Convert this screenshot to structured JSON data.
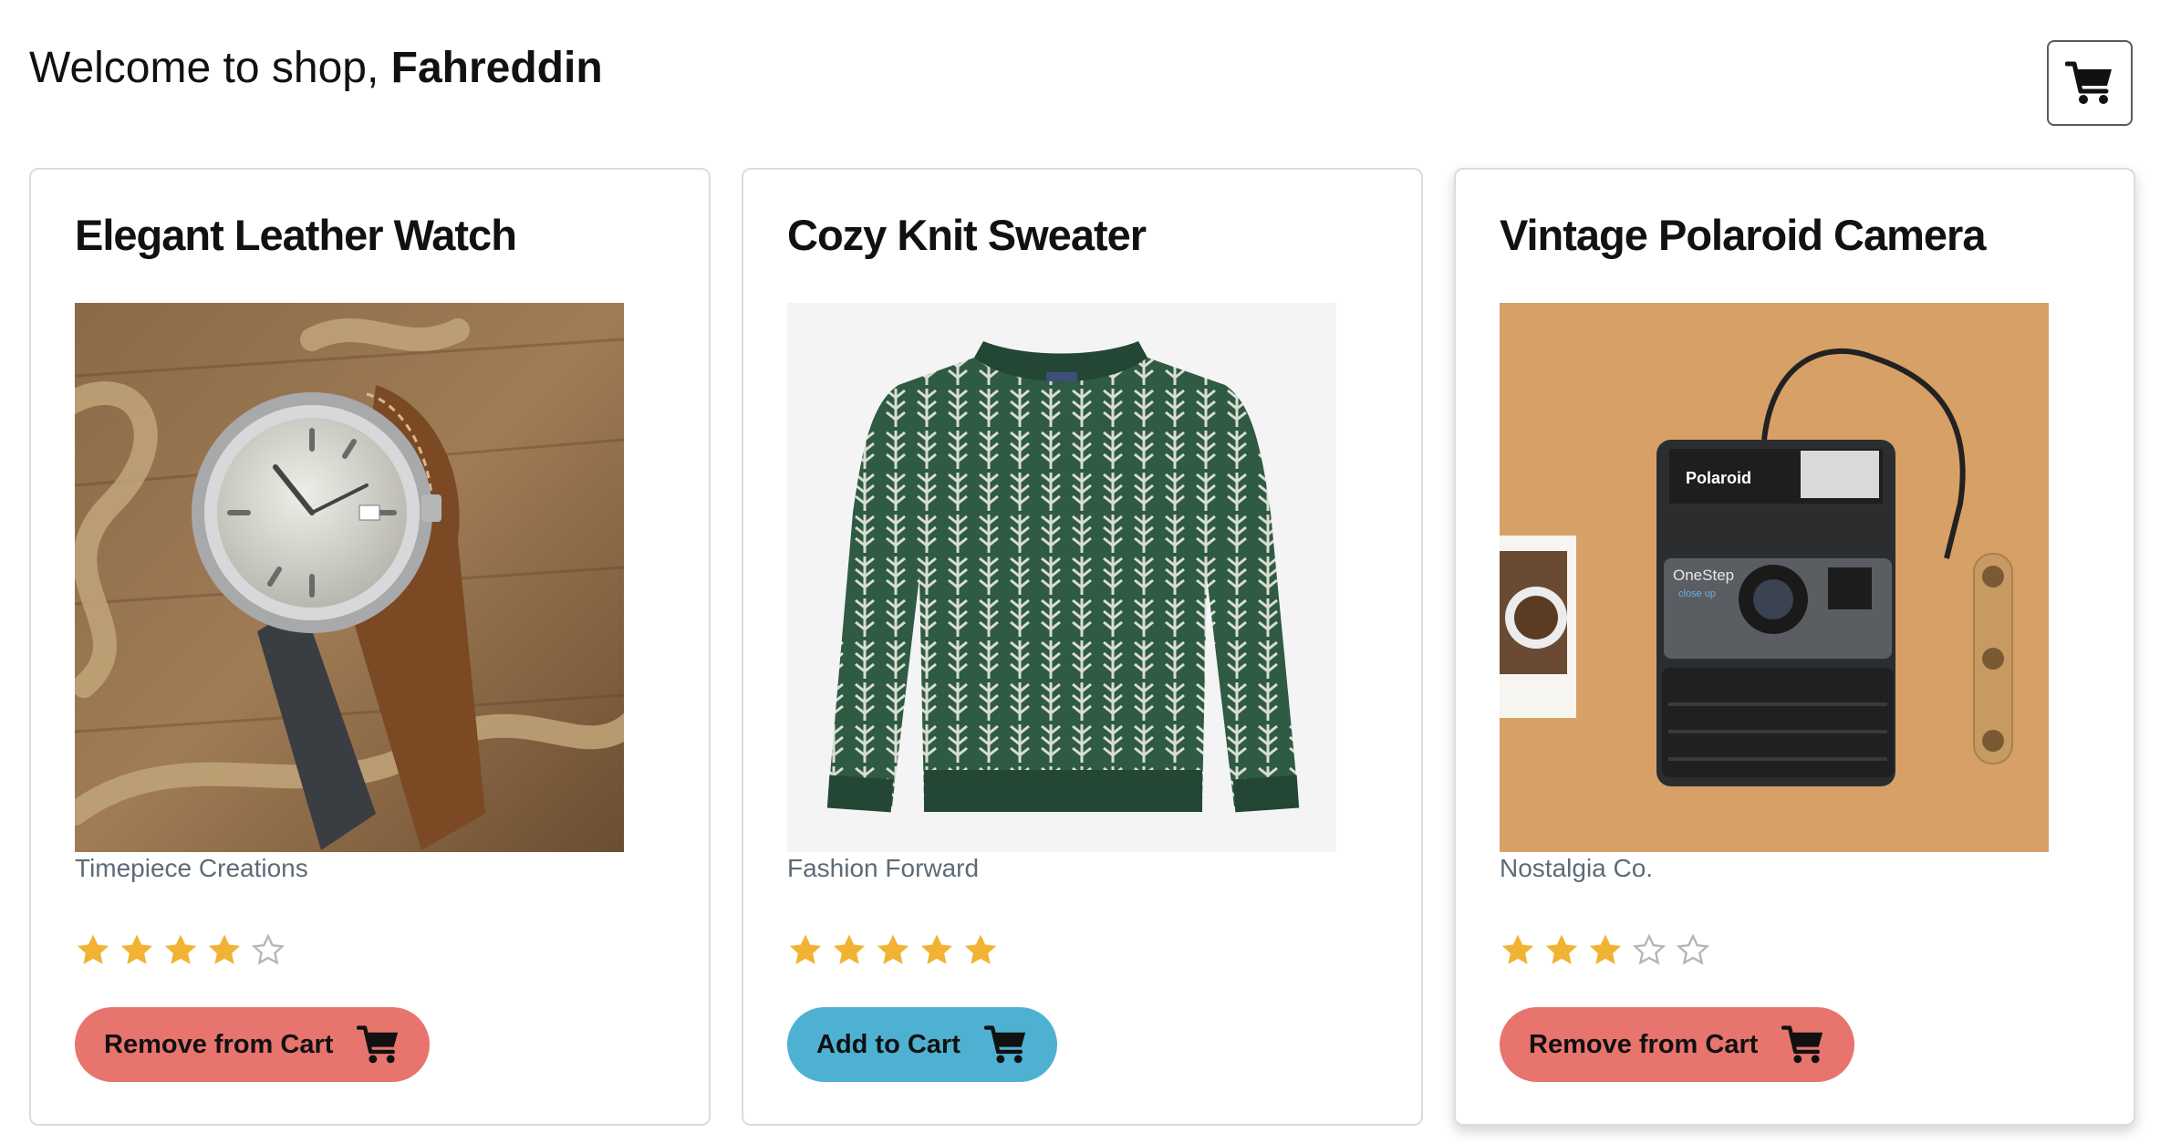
{
  "header": {
    "greeting": "Welcome to shop, ",
    "username": "Fahreddin",
    "cart_icon": "shopping-cart-icon"
  },
  "products": [
    {
      "title": "Elegant Leather Watch",
      "brand": "Timepiece Creations",
      "rating": 4,
      "rating_max": 5,
      "action_label": "Remove from Cart",
      "action_color": "#e8746e",
      "image": "leather-watch-photo"
    },
    {
      "title": "Cozy Knit Sweater",
      "brand": "Fashion Forward",
      "rating": 5,
      "rating_max": 5,
      "action_label": "Add to Cart",
      "action_color": "#4fb1d2",
      "image": "knit-sweater-photo"
    },
    {
      "title": "Vintage Polaroid Camera",
      "brand": "Nostalgia Co.",
      "rating": 3,
      "rating_max": 5,
      "action_label": "Remove from Cart",
      "action_color": "#e8746e",
      "image": "polaroid-camera-photo",
      "image_texts": [
        "Polaroid",
        "OneStep",
        "close up"
      ]
    }
  ],
  "colors": {
    "star_filled": "#f2b233",
    "star_empty": "#b5b5b5"
  }
}
